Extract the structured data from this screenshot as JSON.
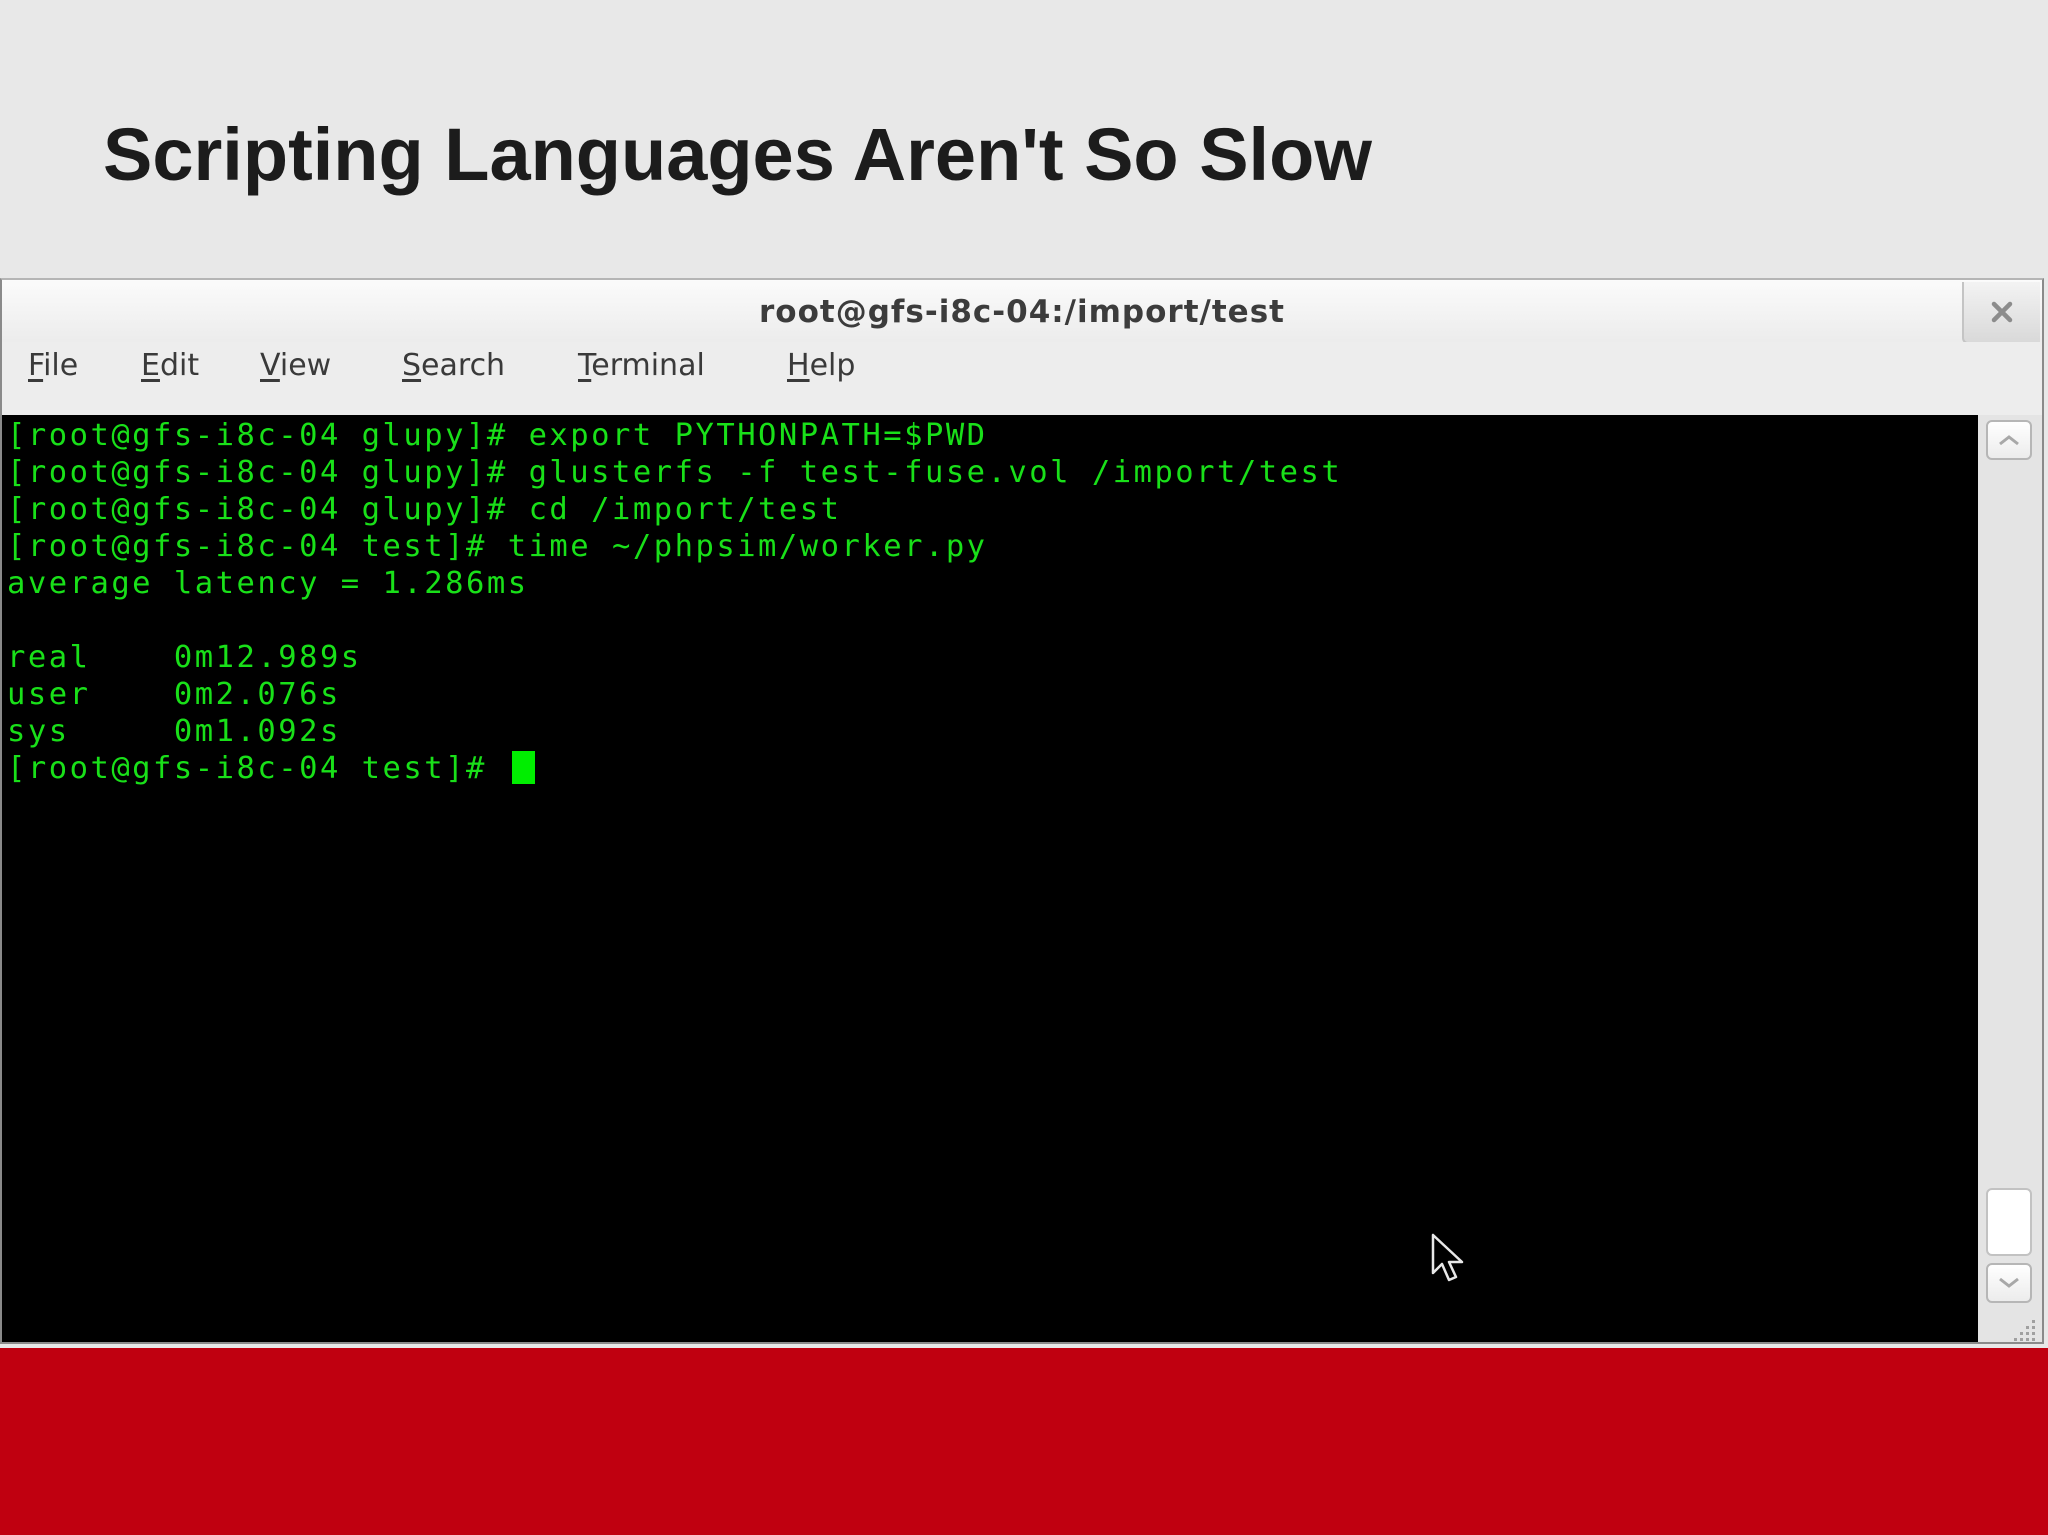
{
  "slide": {
    "title": "Scripting Languages Aren't So Slow"
  },
  "window": {
    "title": "root@gfs-i8c-04:/import/test",
    "close_icon": "close-icon"
  },
  "menubar": {
    "items": [
      {
        "mnemonic": "F",
        "rest": "ile"
      },
      {
        "mnemonic": "E",
        "rest": "dit"
      },
      {
        "mnemonic": "V",
        "rest": "iew"
      },
      {
        "mnemonic": "S",
        "rest": "earch"
      },
      {
        "mnemonic": "T",
        "rest": "erminal"
      },
      {
        "mnemonic": "H",
        "rest": "elp"
      }
    ]
  },
  "terminal": {
    "lines": [
      "[root@gfs-i8c-04 glupy]# export PYTHONPATH=$PWD",
      "[root@gfs-i8c-04 glupy]# glusterfs -f test-fuse.vol /import/test",
      "[root@gfs-i8c-04 glupy]# cd /import/test",
      "[root@gfs-i8c-04 test]# time ~/phpsim/worker.py",
      "average latency = 1.286ms",
      "",
      "real    0m12.989s",
      "user    0m2.076s",
      "sys     0m1.092s"
    ],
    "prompt": "[root@gfs-i8c-04 test]# "
  },
  "colors": {
    "terminal_text": "#19e019",
    "terminal_bg": "#000000",
    "footer_band": "#c00010"
  }
}
